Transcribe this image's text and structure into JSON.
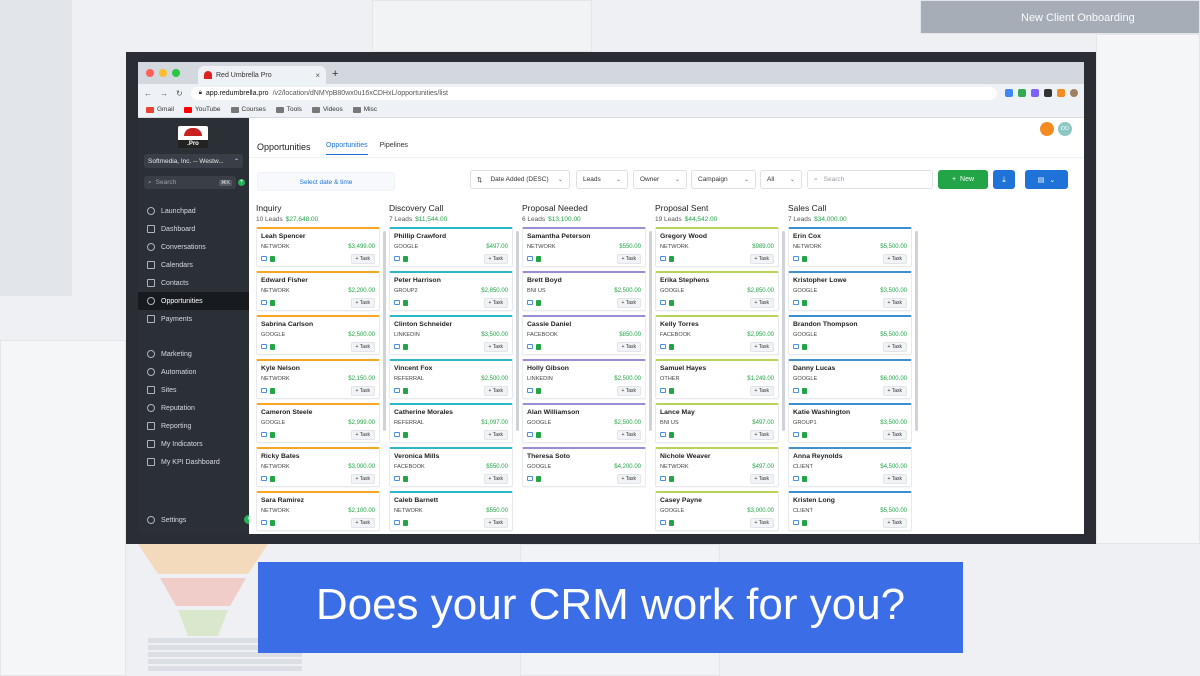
{
  "background": {
    "onboarding_title": "New Client Onboarding"
  },
  "browser": {
    "tab_title": "Red Umbrella Pro",
    "url_host": "app.redumbrella.pro",
    "url_path": "/v2/location/dNMYpB80wx0u16xCDHxL/opportunities/list",
    "bookmarks": [
      "Gmail",
      "YouTube",
      "Courses",
      "Tools",
      "Videos",
      "Misc"
    ]
  },
  "sidebar": {
    "logo_text": ".Pro",
    "account": "Softmedia, Inc. -- Westw...",
    "search_placeholder": "Search",
    "search_kbd": "⌘K",
    "items": [
      {
        "label": "Launchpad"
      },
      {
        "label": "Dashboard"
      },
      {
        "label": "Conversations"
      },
      {
        "label": "Calendars"
      },
      {
        "label": "Contacts"
      },
      {
        "label": "Opportunities"
      },
      {
        "label": "Payments"
      },
      {
        "label": "Marketing"
      },
      {
        "label": "Automation"
      },
      {
        "label": "Sites"
      },
      {
        "label": "Reputation"
      },
      {
        "label": "Reporting"
      },
      {
        "label": "My Indicators"
      },
      {
        "label": "My KPI Dashboard"
      }
    ],
    "settings": "Settings"
  },
  "header": {
    "title": "Opportunities",
    "tabs": [
      "Opportunities",
      "Pipelines"
    ],
    "avatar_initials": "DD"
  },
  "filters": {
    "date_label": "Select date & time",
    "sort": "Date Added (DESC)",
    "leads": "Leads",
    "owner": "Owner",
    "campaign": "Campaign",
    "all": "All",
    "search_placeholder": "Search",
    "new_label": "New"
  },
  "columns": [
    {
      "name": "Inquiry",
      "count": "10 Leads",
      "total": "$27,648.00",
      "cards": [
        {
          "name": "Leah Spencer",
          "source": "NETWORK",
          "value": "$3,499.00"
        },
        {
          "name": "Edward Fisher",
          "source": "NETWORK",
          "value": "$2,200.00"
        },
        {
          "name": "Sabrina Carlson",
          "source": "GOOGLE",
          "value": "$2,500.00"
        },
        {
          "name": "Kyle Nelson",
          "source": "NETWORK",
          "value": "$2,150.00"
        },
        {
          "name": "Cameron Steele",
          "source": "GOOGLE",
          "value": "$2,999.00"
        },
        {
          "name": "Ricky Bates",
          "source": "NETWORK",
          "value": "$3,000.00"
        },
        {
          "name": "Sara Ramirez",
          "source": "NETWORK",
          "value": "$2,100.00"
        }
      ]
    },
    {
      "name": "Discovery Call",
      "count": "7 Leads",
      "total": "$11,544.00",
      "cards": [
        {
          "name": "Phillip Crawford",
          "source": "GOOGLE",
          "value": "$497.00"
        },
        {
          "name": "Peter Harrison",
          "source": "GROUP2",
          "value": "$2,850.00"
        },
        {
          "name": "Clinton Schneider",
          "source": "LINKEDIN",
          "value": "$3,500.00"
        },
        {
          "name": "Vincent Fox",
          "source": "REFERRAL",
          "value": "$2,500.00"
        },
        {
          "name": "Catherine Morales",
          "source": "REFERRAL",
          "value": "$1,097.00"
        },
        {
          "name": "Veronica Mills",
          "source": "FACEBOOK",
          "value": "$550.00"
        },
        {
          "name": "Caleb Barnett",
          "source": "NETWORK",
          "value": "$550.00"
        }
      ]
    },
    {
      "name": "Proposal Needed",
      "count": "6 Leads",
      "total": "$13,100.00",
      "cards": [
        {
          "name": "Samantha Peterson",
          "source": "NETWORK",
          "value": "$550.00"
        },
        {
          "name": "Brett Boyd",
          "source": "BNI US",
          "value": "$2,500.00"
        },
        {
          "name": "Cassie Daniel",
          "source": "FACEBOOK",
          "value": "$850.00"
        },
        {
          "name": "Holly Gibson",
          "source": "LINKEDIN",
          "value": "$2,500.00"
        },
        {
          "name": "Alan Williamson",
          "source": "GOOGLE",
          "value": "$2,500.00"
        },
        {
          "name": "Theresa Soto",
          "source": "GOOGLE",
          "value": "$4,200.00"
        }
      ]
    },
    {
      "name": "Proposal Sent",
      "count": "19 Leads",
      "total": "$44,542.00",
      "cards": [
        {
          "name": "Gregory Wood",
          "source": "NETWORK",
          "value": "$989.00"
        },
        {
          "name": "Erika Stephens",
          "source": "GOOGLE",
          "value": "$2,850.00"
        },
        {
          "name": "Kelly Torres",
          "source": "FACEBOOK",
          "value": "$2,950.00"
        },
        {
          "name": "Samuel Hayes",
          "source": "OTHER",
          "value": "$1,249.00"
        },
        {
          "name": "Lance May",
          "source": "BNI US",
          "value": "$497.00"
        },
        {
          "name": "Nichole Weaver",
          "source": "NETWORK",
          "value": "$497.00"
        },
        {
          "name": "Casey Payne",
          "source": "GOOGLE",
          "value": "$3,000.00"
        }
      ]
    },
    {
      "name": "Sales Call",
      "count": "7 Leads",
      "total": "$34,000.00",
      "cards": [
        {
          "name": "Erin Cox",
          "source": "NETWORK",
          "value": "$5,500.00"
        },
        {
          "name": "Kristopher Lowe",
          "source": "GOOGLE",
          "value": "$3,500.00"
        },
        {
          "name": "Brandon Thompson",
          "source": "GOOGLE",
          "value": "$5,500.00"
        },
        {
          "name": "Danny Lucas",
          "source": "GOOGLE",
          "value": "$6,000.00"
        },
        {
          "name": "Katie Washington",
          "source": "GROUP1",
          "value": "$3,500.00"
        },
        {
          "name": "Anna Reynolds",
          "source": "CLIENT",
          "value": "$4,500.00"
        },
        {
          "name": "Kristen Long",
          "source": "CLIENT",
          "value": "$5,500.00"
        }
      ]
    }
  ],
  "card_task_label": "+ Task",
  "banner": "Does your CRM work for you?",
  "colors": {
    "accent_blue": "#1f72d8",
    "green": "#22a447",
    "sidebar_bg": "#2b2f36",
    "banner_bg": "#3b6ee6",
    "card_top_colors": [
      "#f5a623",
      "#2db5c8",
      "#9b8ad6",
      "#b8d35a",
      "#3d8fd0"
    ]
  }
}
